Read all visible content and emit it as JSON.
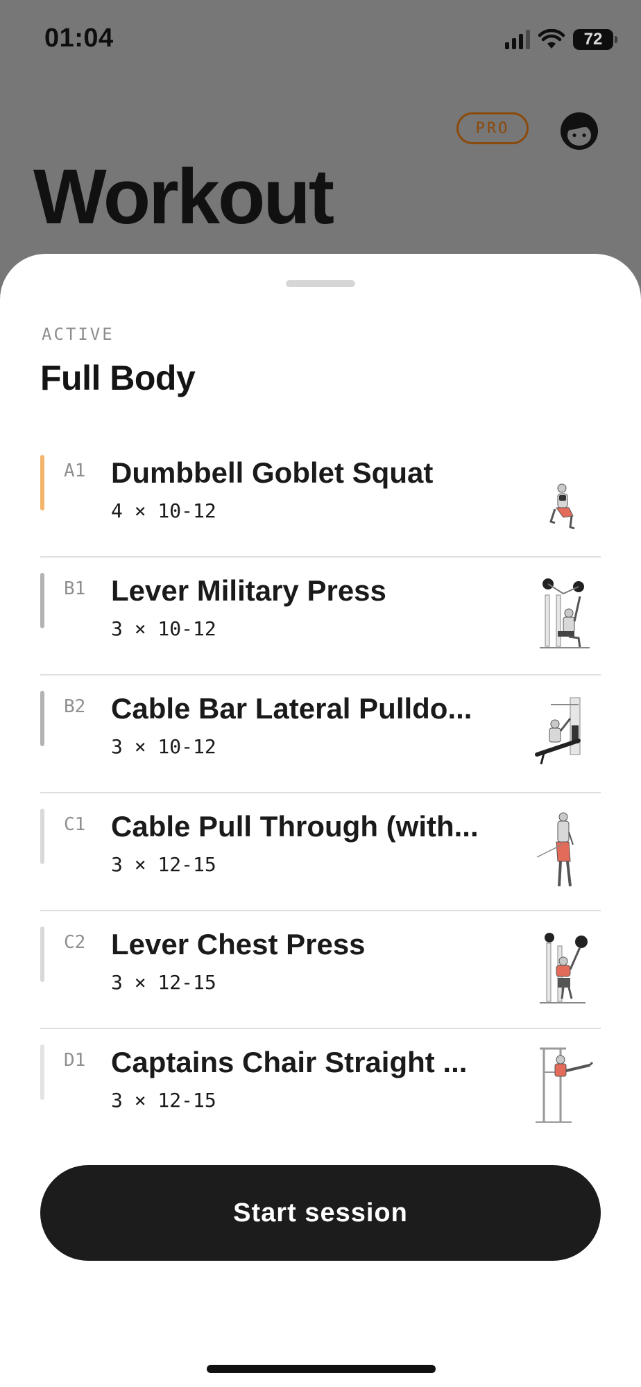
{
  "status_bar": {
    "time": "01:04",
    "battery_percent": "72"
  },
  "header": {
    "pro_badge": "PRO",
    "title": "Workout"
  },
  "sheet": {
    "section_label": "ACTIVE",
    "workout_name": "Full Body",
    "exercises": [
      {
        "code": "A1",
        "name": "Dumbbell Goblet Squat",
        "sets": "4 × 10-12",
        "group_color": "#F2B56B",
        "thumbnail_icon": "goblet-squat-figure-icon"
      },
      {
        "code": "B1",
        "name": "Lever Military Press",
        "sets": "3 × 10-12",
        "group_color": "#B3B3B3",
        "thumbnail_icon": "military-press-machine-icon"
      },
      {
        "code": "B2",
        "name": "Cable Bar Lateral Pulldo...",
        "sets": "3 × 10-12",
        "group_color": "#B3B3B3",
        "thumbnail_icon": "lat-pulldown-machine-icon"
      },
      {
        "code": "C1",
        "name": "Cable Pull Through (with...",
        "sets": "3 × 12-15",
        "group_color": "#D9D9D9",
        "thumbnail_icon": "cable-pull-through-figure-icon"
      },
      {
        "code": "C2",
        "name": "Lever Chest Press",
        "sets": "3 × 12-15",
        "group_color": "#D9D9D9",
        "thumbnail_icon": "chest-press-machine-icon"
      },
      {
        "code": "D1",
        "name": "Captains Chair Straight ...",
        "sets": "3 × 12-15",
        "group_color": "#E3E3E3",
        "thumbnail_icon": "captains-chair-figure-icon"
      }
    ],
    "start_button_label": "Start session"
  },
  "colors": {
    "backdrop": "#777777",
    "accent_pro": "#8A4A0C",
    "button_bg": "#1C1C1C"
  }
}
